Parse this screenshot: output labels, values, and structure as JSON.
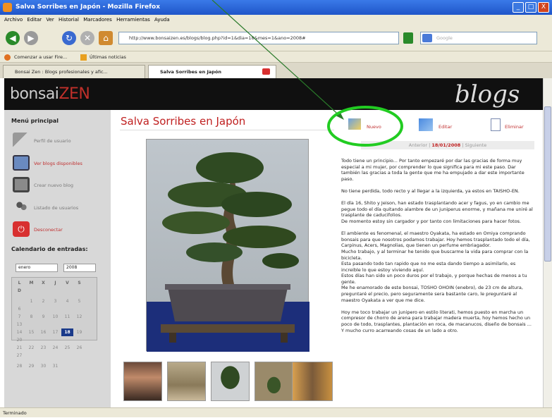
{
  "window": {
    "title": "Salva Sorribes en Japón - Mozilla Firefox",
    "min": "_",
    "max": "□",
    "close": "X"
  },
  "menu": [
    "Archivo",
    "Editar",
    "Ver",
    "Historial",
    "Marcadores",
    "Herramientas",
    "Ayuda"
  ],
  "nav": {
    "url": "http://www.bonsaizen.es/blogs/blog.php?id=1&dia=18&mes=1&ano=2008#",
    "search_placeholder": "Google"
  },
  "bookmarks": [
    "Comenzar a usar Fire...",
    "Últimas noticias"
  ],
  "tabs": [
    {
      "label": "Bonsai Zen : Blogs profesionales y afic..."
    },
    {
      "label": "Salva Sorribes en Japón"
    }
  ],
  "brand": {
    "part1": "bonsai",
    "part2": "ZEN",
    "section": "blogs"
  },
  "sidebar": {
    "heading": "Menú principal",
    "items": [
      "Perfil de usuario",
      "Ver blogs disponibles",
      "Crear nuevo blog",
      "Listado de usuarios",
      "Desconectar"
    ],
    "calendar_heading": "Calendario de entradas:",
    "month": "enero",
    "year": "2008",
    "weekdays": [
      "L",
      "M",
      "X",
      "J",
      "V",
      "S",
      "D"
    ],
    "days": [
      [
        "",
        "1",
        "2",
        "3",
        "4",
        "5",
        "6"
      ],
      [
        "7",
        "8",
        "9",
        "10",
        "11",
        "12",
        "13"
      ],
      [
        "14",
        "15",
        "16",
        "17",
        "18",
        "19",
        "20"
      ],
      [
        "21",
        "22",
        "23",
        "24",
        "25",
        "26",
        "27"
      ],
      [
        "28",
        "29",
        "30",
        "31",
        "",
        "",
        ""
      ]
    ],
    "today": "18"
  },
  "post": {
    "title": "Salva Sorribes en Japón",
    "actions": [
      "Nuevo",
      "Editar",
      "Eliminar"
    ],
    "nav": {
      "prev": "Anterior",
      "date": "18/01/2008",
      "next": "Siguiente"
    },
    "body": "Todo tiene un principio... Por tanto empezaré por dar las gracias de forma muy especial a mi mujer, por comprender lo que significa para mi este paso. Dar también las gracias a toda la gente que me ha empujado a dar este importante paso.\n\nNo tiene perdida, todo recto y al llegar a la izquierda, ya estos en TAISHO-EN.\n\nEl día 16, Shito y Jeison, han estado trasplantando acer y fagus, yo en cambio me pegue todo el día quitando alambre de un juniperus enorme, y mañana me uniré al trasplante de caducifolios.\nDe momento estoy sin cargador y por tanto con limitaciones para hacer fotos.\n\nEl ambiente es fenomenal, el maestro Oyakata, ha estado en Omiya comprando bonsais para que nosotros podamos trabajar. Hoy hemos trasplantado todo el día, Carpinus, Acers, Magnolias, que tienen un perfume embriagador.\nMucho trabajo, y al terminar he tenido que buscarme la vida para comprar con la bicicleta.\nEsta pasando todo tan rapido que no me esta dando tiempo a asimilarlo, es increible lo que estoy viviendo aquí.\nEstos días han sido un poco duros por el trabajo, y porque hechas de menos a tu gente.\nMe he enamorado de este bonsai, TOSHO OHOIN (enebro), de 23 cm de altura, preguntaré el precio, pero seguramente sera bastante caro, le preguntaré al maestro Oyakata a ver que me dice.\n\nHoy me toco trabajar un junipero en estilo literati, hemos puesto en marcha un compresor de chorro de arena para trabajar madera muerta, hoy hemos hecho un poco de todo, trasplantes, plantación en roca, de macanucos, diseño de bonsais ... Y mucho curro acarreando cosas de un lado a otro."
  },
  "status": "Terminado",
  "colors": {
    "accent": "#c02020",
    "annotation": "#22cc22",
    "arrow": "#2a7a2a"
  }
}
